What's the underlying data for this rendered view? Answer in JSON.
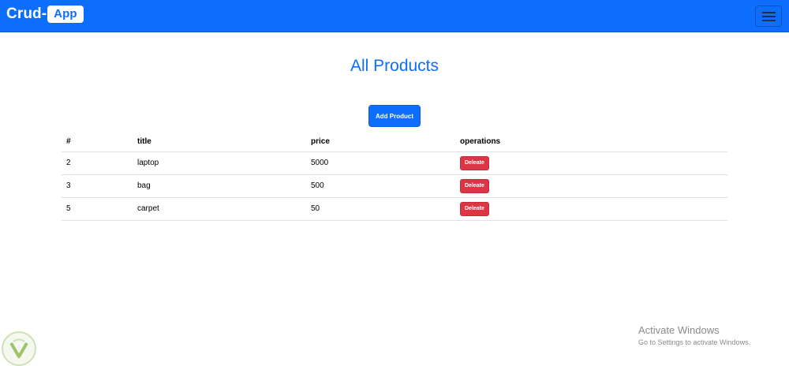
{
  "navbar": {
    "brand_text": "Crud-",
    "brand_badge": "App",
    "toggler_icon": "hamburger-menu-icon"
  },
  "page": {
    "title": "All Products",
    "add_button_label": "Add Product"
  },
  "table": {
    "headers": [
      "#",
      "title",
      "price",
      "operations"
    ],
    "rows": [
      {
        "id": "2",
        "title": "laptop",
        "price": "5000",
        "action": "Deleate"
      },
      {
        "id": "3",
        "title": "bag",
        "price": "500",
        "action": "Deleate"
      },
      {
        "id": "5",
        "title": "carpet",
        "price": "50",
        "action": "Deleate"
      }
    ]
  },
  "windows_watermark": {
    "title": "Activate Windows",
    "subtitle": "Go to Settings to activate Windows."
  },
  "colors": {
    "primary": "#0d6efd",
    "danger": "#dc3545",
    "border": "#dee2e6"
  }
}
